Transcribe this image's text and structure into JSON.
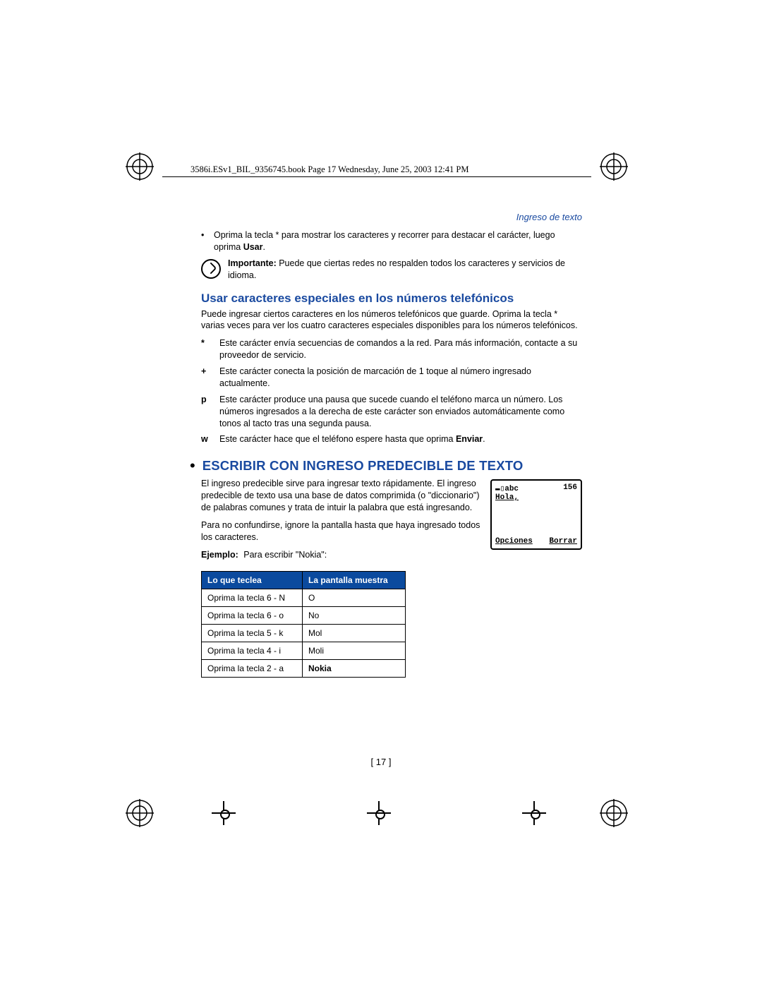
{
  "header_line": "3586i.ESv1_BIL_9356745.book  Page 17  Wednesday, June 25, 2003  12:41 PM",
  "running_head": "Ingreso de texto",
  "intro_bullet": {
    "text_a": "Oprima la tecla * para mostrar los caracteres y recorrer para destacar el carácter, luego oprima ",
    "bold": "Usar",
    "text_b": "."
  },
  "important": {
    "label": "Importante:",
    "text": " Puede que ciertas redes no respalden todos los caracteres y servicios de idioma."
  },
  "section1": {
    "title": "Usar caracteres especiales en los números telefónicos",
    "para": "Puede ingresar ciertos caracteres en los números telefónicos que guarde. Oprima la tecla * varias veces para ver los cuatro caracteres especiales disponibles para los números telefónicos.",
    "defs": [
      {
        "sym": "*",
        "text": "Este carácter envía secuencias de comandos a la red. Para más información, contacte a su proveedor de servicio."
      },
      {
        "sym": "+",
        "text": "Este carácter conecta la posición de marcación de 1 toque al número ingresado actualmente."
      },
      {
        "sym": "p",
        "text": "Este carácter produce una pausa que sucede cuando el teléfono marca un número. Los números ingresados a la derecha de este carácter son enviados automáticamente como tonos al tacto tras una segunda pausa."
      },
      {
        "sym": "w",
        "text_a": "Este carácter hace que el teléfono espere hasta que oprima ",
        "bold": "Enviar",
        "text_b": "."
      }
    ]
  },
  "section2": {
    "title": "ESCRIBIR CON INGRESO PREDECIBLE DE TEXTO",
    "para1": "El ingreso predecible sirve para ingresar texto rápidamente. El ingreso predecible de texto usa una base de datos comprimida (o \"diccionario\") de palabras comunes y trata de intuir la palabra que está ingresando.",
    "para2": "Para no confundirse, ignore la pantalla hasta que haya ingresado todos los caracteres.",
    "example_label": "Ejemplo:",
    "example_text": " Para escribir \"Nokia\":"
  },
  "phone": {
    "top_left": "▬▯abc",
    "top_right": "156",
    "mid": "Hola,",
    "bottom_left": "Opciones",
    "bottom_right": "Borrar"
  },
  "table": {
    "headers": [
      "Lo que teclea",
      "La pantalla muestra"
    ],
    "rows": [
      [
        "Oprima la tecla 6 - N",
        "O"
      ],
      [
        "Oprima la tecla 6 - o",
        "No"
      ],
      [
        "Oprima la tecla 5 - k",
        "Mol"
      ],
      [
        "Oprima la tecla 4 - i",
        "Moli"
      ],
      [
        "Oprima la tecla 2 - a",
        "Nokia"
      ]
    ]
  },
  "page_number": "[ 17 ]"
}
